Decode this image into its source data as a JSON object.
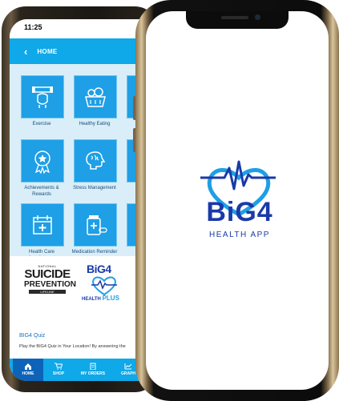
{
  "back_phone": {
    "status_time": "11:25",
    "header": {
      "back_icon": "chevron-left-icon",
      "title": "HOME"
    },
    "tiles": [
      {
        "label": "Exercise",
        "icon": "fitness-icon"
      },
      {
        "label": "Healthy Eating",
        "icon": "food-basket-icon"
      },
      {
        "label": "Mi",
        "icon": "partial-icon"
      },
      {
        "label": "Achievements & Rewards",
        "icon": "award-badge-icon"
      },
      {
        "label": "Stress Management",
        "icon": "brain-icon"
      },
      {
        "label": "C",
        "icon": "partial-icon"
      },
      {
        "label": "Health Care Appointment",
        "icon": "calendar-plus-icon"
      },
      {
        "label": "Medication Reminder",
        "icon": "medicine-bottle-icon"
      },
      {
        "label": "",
        "icon": "partial-icon"
      }
    ],
    "logos": {
      "suicide_prevention": {
        "top": "NATIONAL",
        "line1": "SUICIDE",
        "line2": "PREVENTION",
        "bottom": "LIFELINE"
      },
      "health_plus": {
        "title": "BiG4",
        "sub": "HEALTH",
        "sub_bold": "PLUS"
      }
    },
    "quiz": {
      "title": "BIG4 Quiz",
      "text": "Play the BIG4 Quiz in Your Location! By answering the"
    },
    "nav": [
      {
        "label": "HOME",
        "active": true
      },
      {
        "label": "SHOP",
        "active": false
      },
      {
        "label": "MY ORDERS",
        "active": false
      },
      {
        "label": "GRAPH",
        "active": false
      }
    ]
  },
  "front_phone": {
    "logo": {
      "title": "BiG4",
      "subtitle": "HEALTH APP"
    }
  },
  "colors": {
    "accent": "#0fa8e8",
    "tile": "#1e9fe6",
    "brand": "#1a3aa8",
    "nav_active": "#0c63b8"
  }
}
